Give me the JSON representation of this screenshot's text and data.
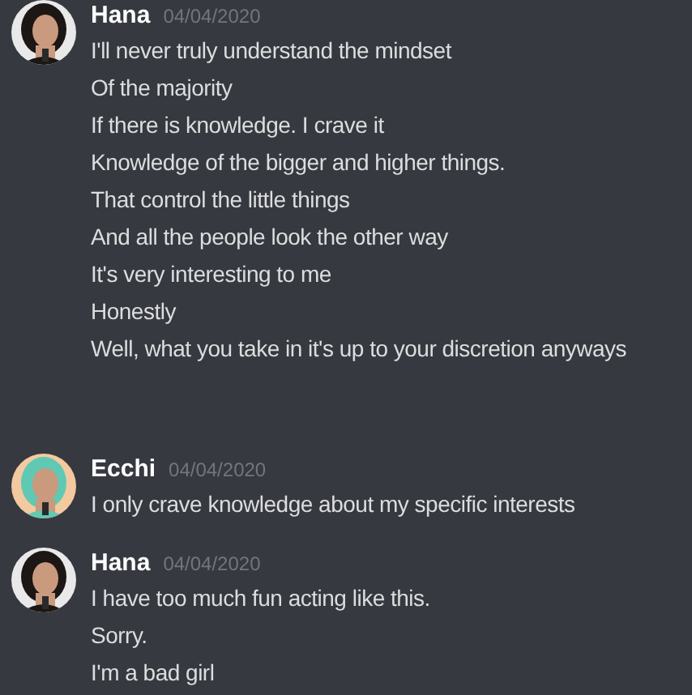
{
  "messages": [
    {
      "author": "Hana",
      "timestamp": "04/04/2020",
      "lines": [
        "I'll never truly understand the mindset",
        "Of the majority",
        "If there is knowledge. I crave it",
        "Knowledge of the bigger and higher things.",
        "That control the little things",
        "And all the people look the other way",
        "It's very interesting to me",
        "Honestly",
        "Well, what you take in it's up to your discretion anyways"
      ]
    },
    {
      "author": "Ecchi",
      "timestamp": "04/04/2020",
      "lines": [
        "I only crave knowledge about my specific interests"
      ]
    },
    {
      "author": "Hana",
      "timestamp": "04/04/2020",
      "lines": [
        "I have too much fun acting like this.",
        "Sorry.",
        "I'm a bad girl"
      ]
    }
  ]
}
